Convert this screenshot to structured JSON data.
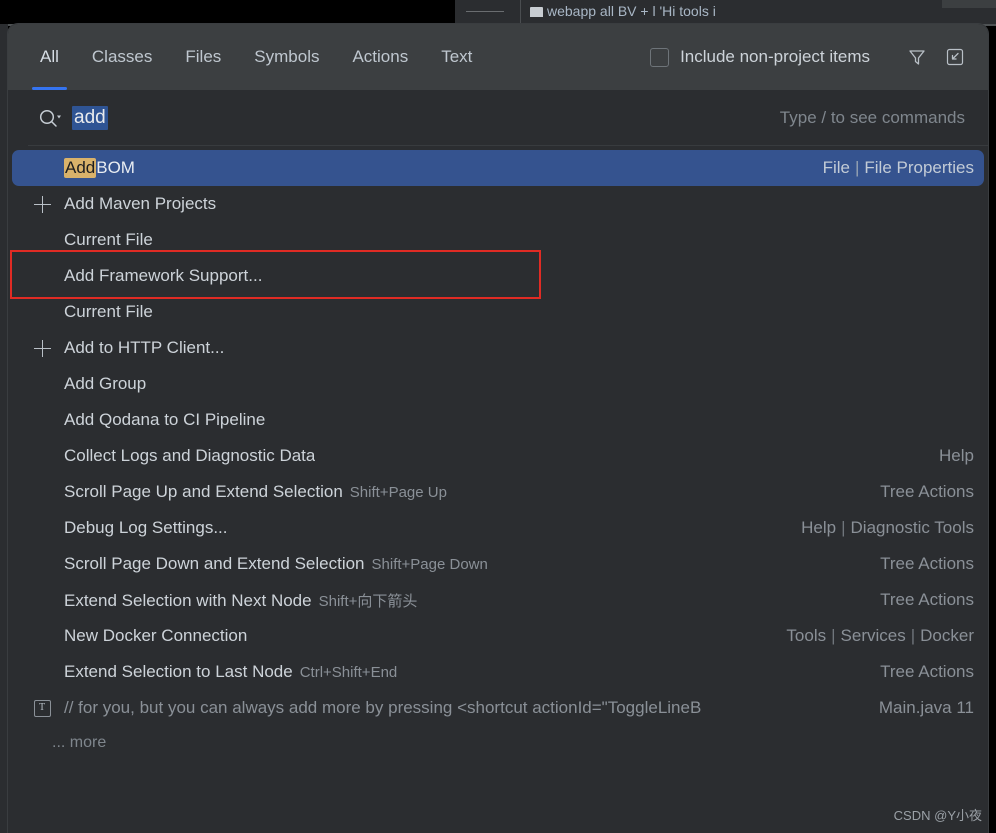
{
  "backdrop": {
    "breadcrumb": "webapp all BV   + l 'Hi tools i"
  },
  "popup": {
    "tabs": [
      {
        "label": "All",
        "active": true
      },
      {
        "label": "Classes",
        "active": false
      },
      {
        "label": "Files",
        "active": false
      },
      {
        "label": "Symbols",
        "active": false
      },
      {
        "label": "Actions",
        "active": false
      },
      {
        "label": "Text",
        "active": false
      }
    ],
    "include_non_project_label": "Include non-project items",
    "filter_icon": "filter-icon",
    "expand_icon": "expand-down-left-icon",
    "search": {
      "icon": "search-icon",
      "value": "add",
      "hint": "Type / to see commands"
    },
    "results": [
      {
        "icon": "none",
        "text_pre": "",
        "text_highlight": "Add",
        "text_post": " BOM",
        "shortcut": "",
        "right": [
          "File",
          "File Properties"
        ],
        "selected": true,
        "comment": false
      },
      {
        "icon": "plus-icon",
        "text_pre": "Add Maven Projects",
        "text_highlight": "",
        "text_post": "",
        "shortcut": "",
        "right": [],
        "selected": false,
        "comment": false
      },
      {
        "icon": "none",
        "text_pre": "Current File",
        "text_highlight": "",
        "text_post": "",
        "shortcut": "",
        "right": [],
        "selected": false,
        "comment": false
      },
      {
        "icon": "none",
        "text_pre": "Add Framework Support...",
        "text_highlight": "",
        "text_post": "",
        "shortcut": "",
        "right": [],
        "selected": false,
        "comment": false
      },
      {
        "icon": "none",
        "text_pre": "Current File",
        "text_highlight": "",
        "text_post": "",
        "shortcut": "",
        "right": [],
        "selected": false,
        "comment": false
      },
      {
        "icon": "plus-icon",
        "text_pre": "Add to HTTP Client...",
        "text_highlight": "",
        "text_post": "",
        "shortcut": "",
        "right": [],
        "selected": false,
        "comment": false
      },
      {
        "icon": "none",
        "text_pre": "Add Group",
        "text_highlight": "",
        "text_post": "",
        "shortcut": "",
        "right": [],
        "selected": false,
        "comment": false
      },
      {
        "icon": "none",
        "text_pre": "Add Qodana to CI Pipeline",
        "text_highlight": "",
        "text_post": "",
        "shortcut": "",
        "right": [],
        "selected": false,
        "comment": false
      },
      {
        "icon": "none",
        "text_pre": "Collect Logs and Diagnostic Data",
        "text_highlight": "",
        "text_post": "",
        "shortcut": "",
        "right": [
          "Help"
        ],
        "selected": false,
        "comment": false
      },
      {
        "icon": "none",
        "text_pre": "Scroll Page Up and Extend Selection",
        "text_highlight": "",
        "text_post": "",
        "shortcut": "Shift+Page Up",
        "right": [
          "Tree Actions"
        ],
        "selected": false,
        "comment": false
      },
      {
        "icon": "none",
        "text_pre": "Debug Log Settings...",
        "text_highlight": "",
        "text_post": "",
        "shortcut": "",
        "right": [
          "Help",
          "Diagnostic Tools"
        ],
        "selected": false,
        "comment": false
      },
      {
        "icon": "none",
        "text_pre": "Scroll Page Down and Extend Selection",
        "text_highlight": "",
        "text_post": "",
        "shortcut": "Shift+Page Down",
        "right": [
          "Tree Actions"
        ],
        "selected": false,
        "comment": false
      },
      {
        "icon": "none",
        "text_pre": "Extend Selection with Next Node",
        "text_highlight": "",
        "text_post": "",
        "shortcut": "Shift+向下箭头",
        "right": [
          "Tree Actions"
        ],
        "selected": false,
        "comment": false
      },
      {
        "icon": "none",
        "text_pre": "New Docker Connection",
        "text_highlight": "",
        "text_post": "",
        "shortcut": "",
        "right": [
          "Tools",
          "Services",
          "Docker"
        ],
        "selected": false,
        "comment": false
      },
      {
        "icon": "none",
        "text_pre": "Extend Selection to Last Node",
        "text_highlight": "",
        "text_post": "",
        "shortcut": "Ctrl+Shift+End",
        "right": [
          "Tree Actions"
        ],
        "selected": false,
        "comment": false
      },
      {
        "icon": "text-file-icon",
        "text_pre": "// for you, but you can always add more by pressing <shortcut actionId=\"ToggleLineB",
        "text_highlight": "",
        "text_post": "",
        "shortcut": "",
        "right": [
          "Main.java 11"
        ],
        "selected": false,
        "comment": true
      }
    ],
    "more_label": "... more"
  },
  "annotation": {
    "color": "#e02b24"
  },
  "watermark": "CSDN @Y小夜"
}
